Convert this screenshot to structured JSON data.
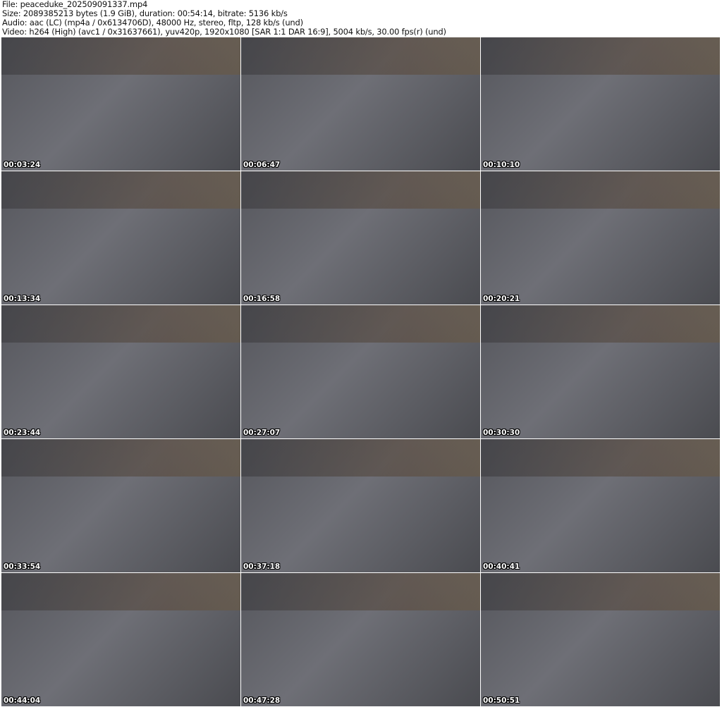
{
  "header": {
    "file": "File: peaceduke_202509091337.mp4",
    "size": "Size: 2089385213 bytes (1.9 GiB), duration: 00:54:14, bitrate: 5136 kb/s",
    "audio": "Audio: aac (LC) (mp4a / 0x6134706D), 48000 Hz, stereo, fltp, 128 kb/s (und)",
    "video": "Video: h264 (High) (avc1 / 0x31637661), yuv420p, 1920x1080 [SAR 1:1 DAR 16:9], 5004 kb/s, 30.00 fps(r) (und)"
  },
  "thumbnails": [
    {
      "time": "00:03:24"
    },
    {
      "time": "00:06:47"
    },
    {
      "time": "00:10:10"
    },
    {
      "time": "00:13:34"
    },
    {
      "time": "00:16:58"
    },
    {
      "time": "00:20:21"
    },
    {
      "time": "00:23:44"
    },
    {
      "time": "00:27:07"
    },
    {
      "time": "00:30:30"
    },
    {
      "time": "00:33:54"
    },
    {
      "time": "00:37:18"
    },
    {
      "time": "00:40:41"
    },
    {
      "time": "00:44:04"
    },
    {
      "time": "00:47:28"
    },
    {
      "time": "00:50:51"
    }
  ]
}
